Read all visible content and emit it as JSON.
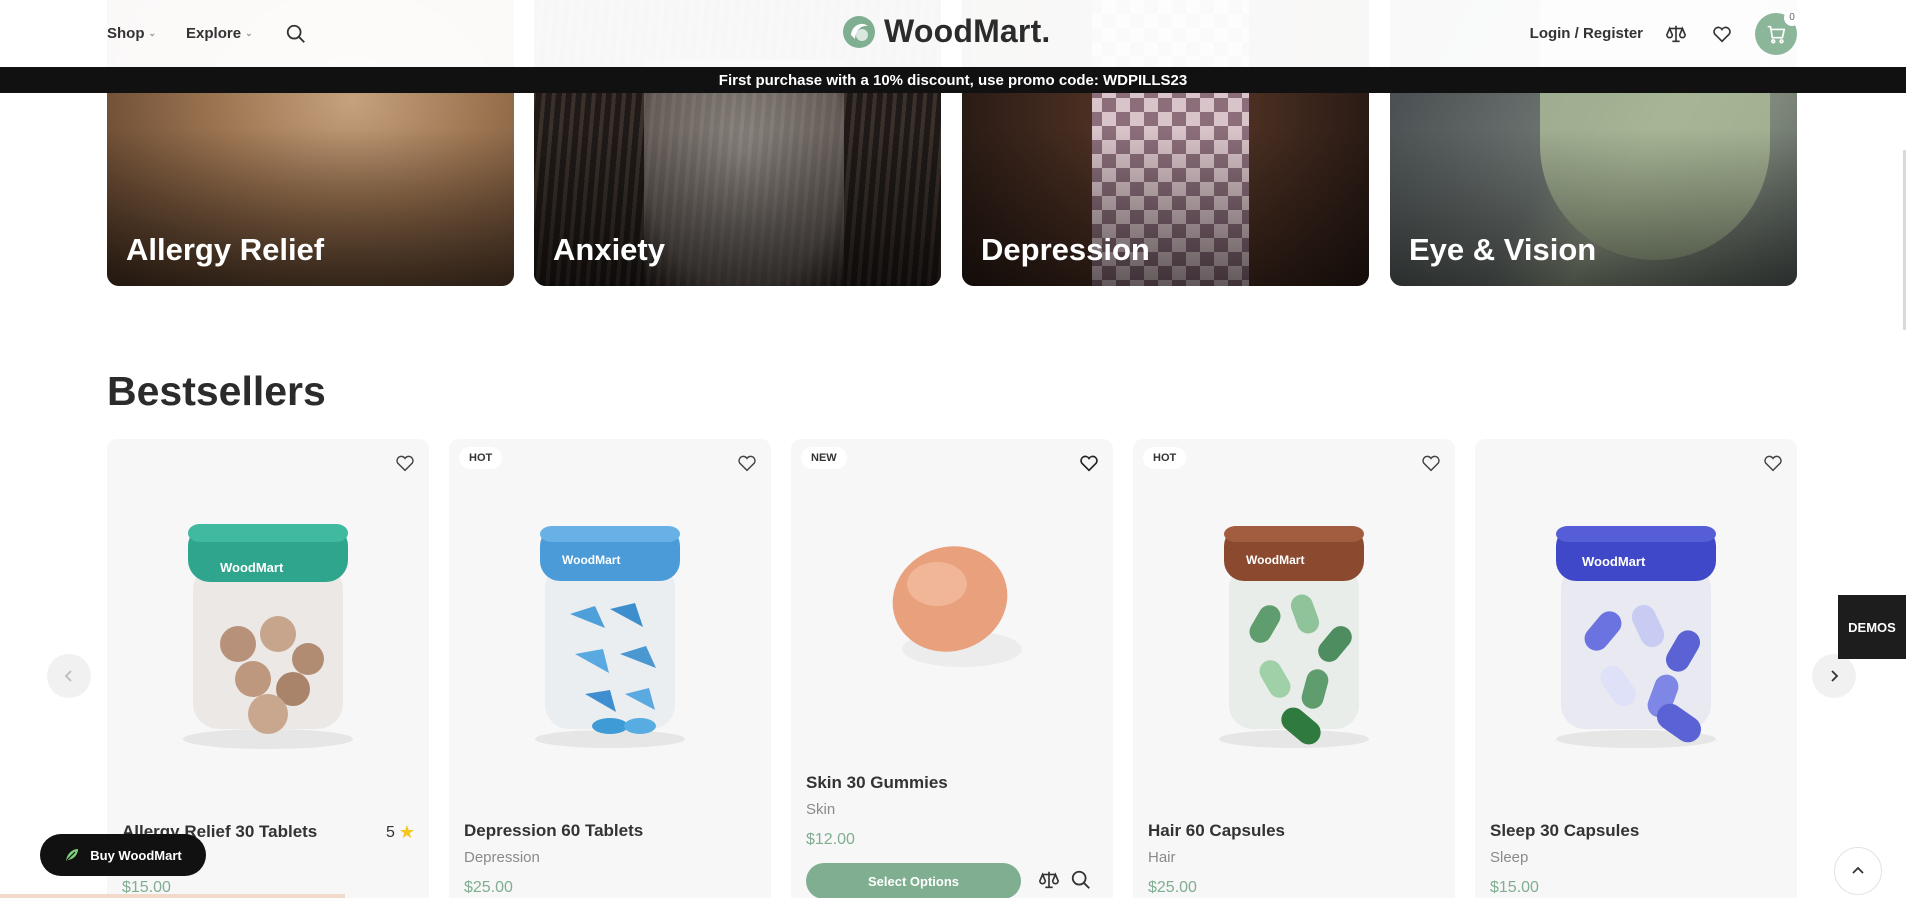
{
  "header": {
    "nav": [
      {
        "label": "Shop"
      },
      {
        "label": "Explore"
      }
    ],
    "logo_text": "WoodMart.",
    "login_label": "Login / Register",
    "cart_count": "0",
    "icons": [
      "search-icon",
      "compare-icon",
      "heart-icon",
      "cart-icon"
    ]
  },
  "promo": {
    "text": "First purchase with a 10% discount, use promo code: WDPILLS23"
  },
  "categories": [
    {
      "label": "Allergy Relief"
    },
    {
      "label": "Anxiety"
    },
    {
      "label": "Depression"
    },
    {
      "label": "Eye & Vision"
    }
  ],
  "bestsellers": {
    "title": "Bestsellers",
    "products": [
      {
        "name": "Allergy Relief 30 Tablets",
        "category": "",
        "price": "$15.00",
        "badge": "",
        "rating": "5",
        "color": "#2fa58d"
      },
      {
        "name": "Depression 60 Tablets",
        "category": "Depression",
        "price": "$25.00",
        "badge": "HOT",
        "color": "#4a9bd8"
      },
      {
        "name": "Skin 30 Gummies",
        "category": "Skin",
        "price": "$12.00",
        "badge": "NEW",
        "button": "Select Options",
        "color": "#e9a07c"
      },
      {
        "name": "Hair 60 Capsules",
        "category": "Hair",
        "price": "$25.00",
        "badge": "HOT",
        "color": "#8b4a30"
      },
      {
        "name": "Sleep 30 Capsules",
        "category": "Sleep",
        "price": "$15.00",
        "badge": "",
        "color": "#3f48c8"
      }
    ]
  },
  "floating": {
    "demos_label": "DEMOS",
    "buy_label": "Buy WoodMart"
  },
  "colors": {
    "accent": "#7fae90",
    "promo_bg": "#111111",
    "star": "#f5c518"
  }
}
